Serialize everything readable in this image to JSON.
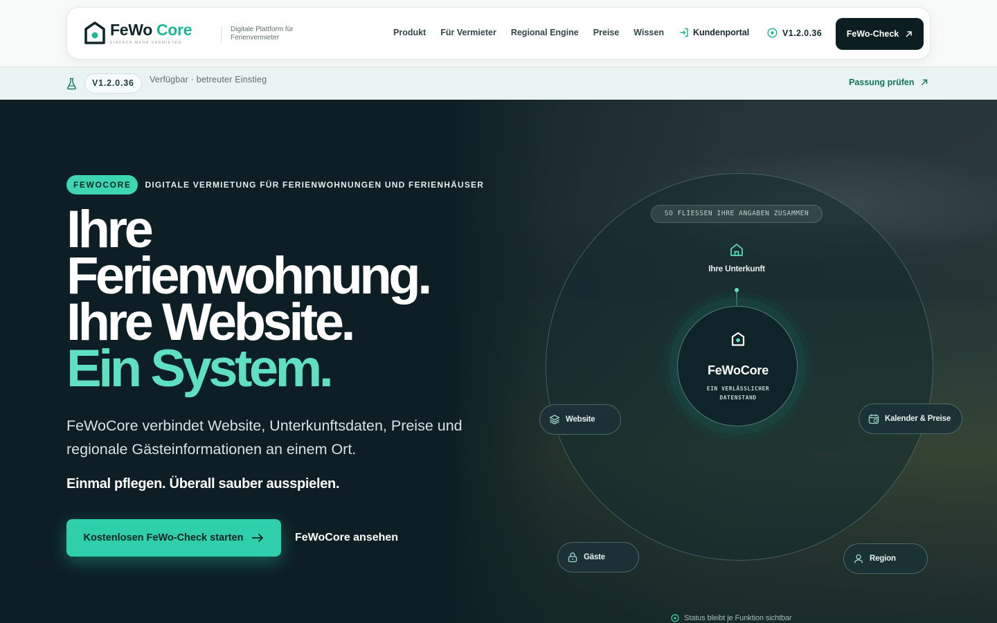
{
  "brand": {
    "name_part1": "FeWo",
    "name_part2": "Core",
    "slogan": "EINFACH MEHR VERMIETEN",
    "tagline": "Digitale Plattform für Ferienvermieter"
  },
  "nav": {
    "links": [
      "Produkt",
      "Für Vermieter",
      "Regional Engine",
      "Preise",
      "Wissen"
    ],
    "portal_label": "Kundenportal",
    "version_label": "V1.2.0.36",
    "cta_label": "FeWo-Check"
  },
  "announcement": {
    "version": "V1.2.0.36",
    "text": "Verfügbar · betreuter Einstieg",
    "link_label": "Passung prüfen"
  },
  "hero": {
    "badge": "FEWOCORE",
    "eyebrow": "DIGITALE VERMIETUNG FÜR FERIENWOHNUNGEN UND FERIENHÄUSER",
    "headline_line1": "Ihre",
    "headline_line2": "Ferienwohnung.",
    "headline_line3": "Ihre Website.",
    "headline_line4": "Ein System.",
    "lead": "FeWoCore verbindet Website, Unterkunftsdaten, Preise und regionale Gästeinformationen an einem Ort.",
    "emphasis": "Einmal pflegen. Überall sauber ausspielen.",
    "primary_cta": "Kostenlosen FeWo-Check starten",
    "secondary_cta": "FeWoCore ansehen"
  },
  "diagram": {
    "flow_label": "SO FLIESSEN IHRE ANGABEN ZUSAMMEN",
    "top_node": "Ihre Unterkunft",
    "core_title": "FeWoCore",
    "core_subtitle": "EIN VERLÄSSLICHER DATENSTAND",
    "nodes": {
      "website": "Website",
      "kalender": "Kalender & Preise",
      "gaeste": "Gäste",
      "region": "Region"
    },
    "status": "Status bleibt je Funktion sichtbar"
  },
  "colors": {
    "accent": "#2fcfac",
    "accent_light": "#5fe0c0",
    "dark": "#0d1f24",
    "announcement_bg": "#e9f3f1"
  }
}
